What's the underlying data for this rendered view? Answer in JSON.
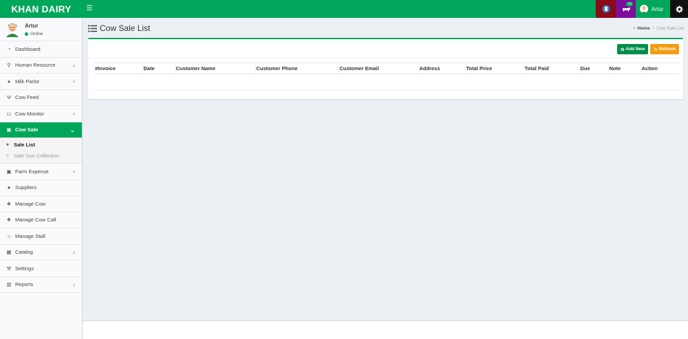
{
  "app": {
    "title": "KHAN DAIRY"
  },
  "navbar": {
    "toggle_icon": "hamburger-icon",
    "notification_badge": "15",
    "user_name": "Artur",
    "settings_icon": "gear-icon"
  },
  "sidebar": {
    "user": {
      "name": "Artur",
      "status": "Online"
    },
    "items": [
      {
        "label": "Dashboard",
        "icon": "dashboard-icon"
      },
      {
        "label": "Human Resource",
        "icon": "user-icon"
      },
      {
        "label": "Milk Parlor",
        "icon": "drop-icon"
      },
      {
        "label": "Cow Feed",
        "icon": "cutlery-icon"
      },
      {
        "label": "Cow Monitor",
        "icon": "monitor-icon"
      },
      {
        "label": "Cow Sale",
        "icon": "money-icon"
      },
      {
        "label": "Farm Expense",
        "icon": "money-icon"
      },
      {
        "label": "Suppliers",
        "icon": "user-icon"
      },
      {
        "label": "Manage Cow",
        "icon": "paw-icon"
      },
      {
        "label": "Manage Cow Calf",
        "icon": "paw-icon"
      },
      {
        "label": "Manage Stall",
        "icon": "home-icon"
      },
      {
        "label": "Catalog",
        "icon": "grid-icon"
      },
      {
        "label": "Settings",
        "icon": "wrench-icon"
      },
      {
        "label": "Reports",
        "icon": "bar-chart-icon"
      }
    ],
    "submenu": [
      {
        "label": "Sale List"
      },
      {
        "label": "Sale Due Collection"
      }
    ]
  },
  "page": {
    "title": "Cow Sale List",
    "breadcrumb": {
      "home": "Home",
      "current": "Cow Sale List"
    }
  },
  "toolbar": {
    "add_label": "Add New",
    "refresh_label": "Refresh"
  },
  "table": {
    "columns": [
      "#Invoice",
      "Date",
      "Customer Name",
      "Customer Phone",
      "Customer Email",
      "Address",
      "Total Price",
      "Total Paid",
      "Due",
      "Note",
      "Action"
    ],
    "rows": []
  },
  "colors": {
    "primary": "#00a65a",
    "warning": "#f39c12",
    "red": "#8b0a15",
    "purple": "#7b0f9b"
  }
}
